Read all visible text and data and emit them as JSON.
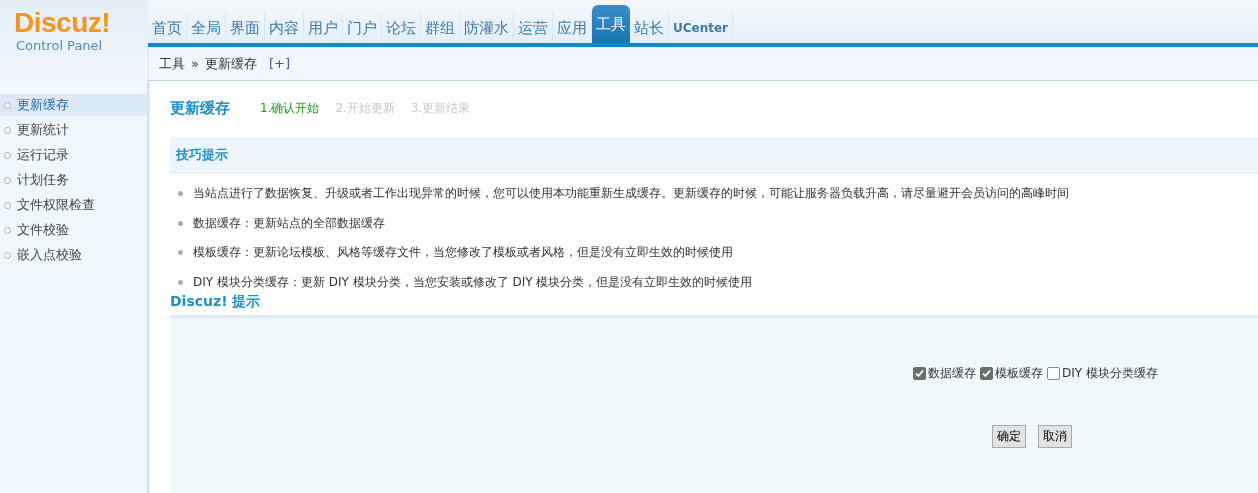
{
  "logo": {
    "title": "Discuz!",
    "subtitle": "Control Panel"
  },
  "nav": [
    {
      "label": "首页",
      "selected": false
    },
    {
      "label": "全局",
      "selected": false
    },
    {
      "label": "界面",
      "selected": false
    },
    {
      "label": "内容",
      "selected": false
    },
    {
      "label": "用户",
      "selected": false
    },
    {
      "label": "门户",
      "selected": false
    },
    {
      "label": "论坛",
      "selected": false
    },
    {
      "label": "群组",
      "selected": false
    },
    {
      "label": "防灌水",
      "selected": false
    },
    {
      "label": "运营",
      "selected": false
    },
    {
      "label": "应用",
      "selected": false
    },
    {
      "label": "工具",
      "selected": true
    },
    {
      "label": "站长",
      "selected": false
    },
    {
      "label": "UCenter",
      "selected": false
    }
  ],
  "breadcrumb": {
    "items": [
      "工具",
      "更新缓存"
    ],
    "separator": "»",
    "add": "[+]"
  },
  "sidebar": {
    "items": [
      {
        "label": "更新缓存",
        "selected": true
      },
      {
        "label": "更新统计",
        "selected": false
      },
      {
        "label": "运行记录",
        "selected": false
      },
      {
        "label": "计划任务",
        "selected": false
      },
      {
        "label": "文件权限检查",
        "selected": false
      },
      {
        "label": "文件校验",
        "selected": false
      },
      {
        "label": "嵌入点校验",
        "selected": false
      }
    ]
  },
  "page_title": "更新缓存",
  "steps": [
    {
      "label": "1.确认开始",
      "selected": true
    },
    {
      "label": "2.开始更新",
      "selected": false
    },
    {
      "label": "3.更新结果",
      "selected": false
    }
  ],
  "tips": {
    "title": "技巧提示",
    "items": [
      "当站点进行了数据恢复、升级或者工作出现异常的时候，您可以使用本功能重新生成缓存。更新缓存的时候，可能让服务器负载升高，请尽量避开会员访问的高峰时间",
      "数据缓存：更新站点的全部数据缓存",
      "模板缓存：更新论坛模板、风格等缓存文件，当您修改了模板或者风格，但是没有立即生效的时候使用",
      "DIY 模块分类缓存：更新 DIY 模块分类，当您安装或修改了 DIY 模块分类，但是没有立即生效的时候使用"
    ]
  },
  "notice": {
    "title": "Discuz! 提示",
    "options": [
      {
        "label": "数据缓存",
        "checked": true
      },
      {
        "label": "模板缓存",
        "checked": true
      },
      {
        "label": "DIY 模块分类缓存",
        "checked": false
      }
    ],
    "buttons": [
      "确定",
      "取消"
    ]
  }
}
